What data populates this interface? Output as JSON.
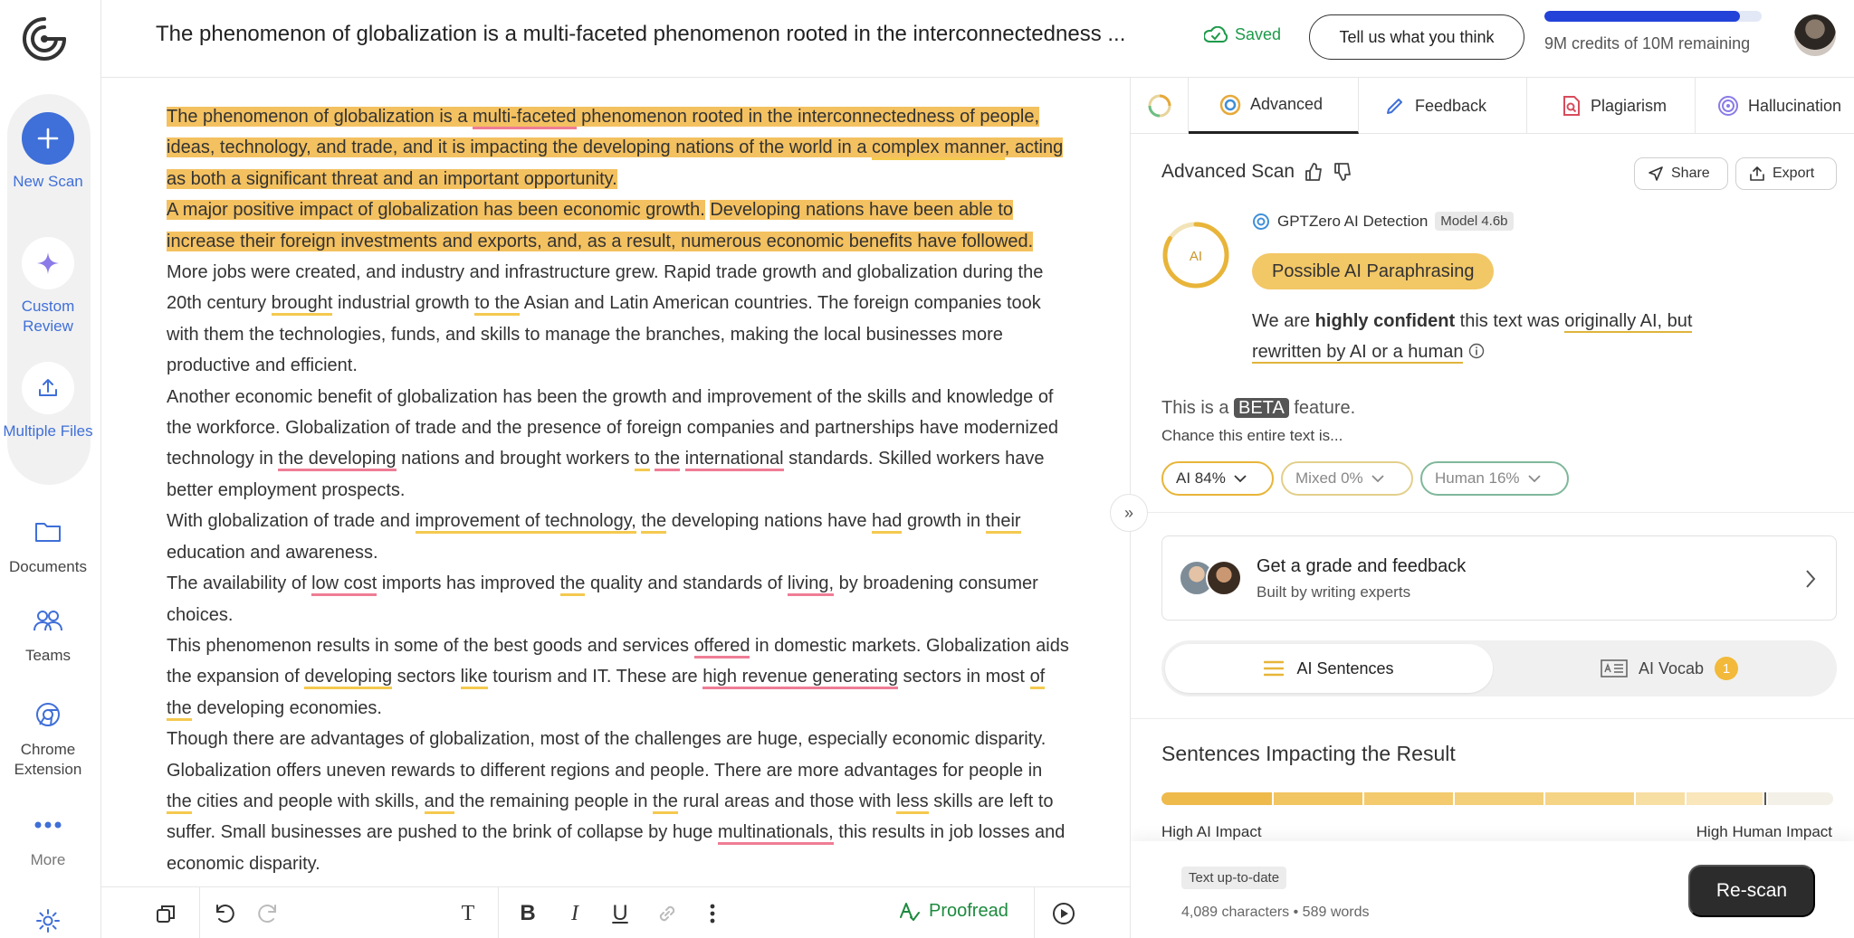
{
  "sidebar": {
    "new_scan": "New Scan",
    "custom_review": "Custom Review",
    "multiple_files": "Multiple Files",
    "documents": "Documents",
    "teams": "Teams",
    "chrome_extension": "Chrome Extension",
    "more": "More",
    "icons": {
      "logo": "gptzero-logo-icon",
      "new_scan": "plus-icon",
      "custom_review": "sparkle-icon",
      "multiple_files": "upload-icon",
      "documents": "folder-icon",
      "teams": "people-icon",
      "chrome_extension": "chrome-icon",
      "more": "dots-icon",
      "settings": "gear-icon"
    }
  },
  "header": {
    "doc_title": "The phenomenon of globalization is a multi-faceted phenomenon rooted in the interconnectedness ...",
    "saved": "Saved",
    "feedback_button": "Tell us what you think",
    "credits_text": "9M credits of 10M remaining",
    "credits_fraction": 0.9
  },
  "essay": {
    "p1": {
      "s1_a": "The phenomenon of globalization is a ",
      "s1_u1": "multi-faceted",
      "s1_b": " phenomenon rooted in the interconnectedness of people, ideas, technology, and trade, and it is impacting the developing nations of the world in a ",
      "s1_u2": "complex manner",
      "s1_c": ", acting as both a significant threat and an important opportunity."
    },
    "p2": {
      "h1": "A major positive impact of globalization has been economic growth.",
      "h2": "Developing nations have been able to increase their foreign investments and exports, and, as a result, numerous economic benefits have followed.",
      "a": " More jobs were created, and industry and infrastructure grew. Rapid trade growth and globalization during the 20th century ",
      "u1": "brought",
      "b": " industrial growth ",
      "u2": "to the",
      "c": " Asian and Latin American countries. The foreign companies took with them the technologies, funds, and skills to manage the branches, making the local businesses more productive and efficient."
    },
    "p3": {
      "a": "Another economic benefit of globalization has been the growth and improvement of the skills and knowledge of the workforce. Globalization of trade and the presence of foreign companies and partnerships have modernized technology in ",
      "r1": "the developing",
      "b": " nations and brought workers ",
      "y1": "to",
      "c": " ",
      "r2": "the",
      "d": " ",
      "r3": "international",
      "e": " standards. Skilled workers have better employment prospects."
    },
    "p4": {
      "a": "With globalization of trade and ",
      "y1": "improvement of technology,",
      "b": " ",
      "y2": "the",
      "c": " developing nations have ",
      "y3": "had",
      "d": " growth in ",
      "y4": "their",
      "e": " education and awareness."
    },
    "p5": {
      "a": "The availability of ",
      "r1": "low cost",
      "b": " imports has improved ",
      "y1": "the",
      "c": " quality and standards of ",
      "r2": "living,",
      "d": " by broadening consumer choices."
    },
    "p6": {
      "a": "This phenomenon results in some of the best goods and services ",
      "r1": "offered",
      "b": " in domestic markets. Globalization aids the expansion of ",
      "y1": "developing",
      "c": " sectors ",
      "y2": "like",
      "d": " tourism and IT. These are ",
      "r2": "high revenue generating",
      "e": " sectors in most ",
      "y3": "of the",
      "f": " developing economies."
    },
    "p7": {
      "a": "Though there are advantages of globalization, most of the challenges are huge, especially economic disparity. Globalization offers uneven rewards to different regions and people. There are more advantages for people in ",
      "y1": "the",
      "b": " cities and people with skills, ",
      "y2": "and",
      "c": " the remaining people in ",
      "y3": "the",
      "d": " rural areas and those with ",
      "y4": "less",
      "e": " skills are left to suffer. Small businesses are pushed to the brink of collapse by huge ",
      "r1": "multinationals,",
      "f": " this results in job losses and economic disparity."
    }
  },
  "toolbar": {
    "proofread": "Proofread",
    "icons": [
      "copy-icon",
      "undo-icon",
      "redo-icon",
      "text-format-icon",
      "bold-icon",
      "italic-icon",
      "underline-icon",
      "link-icon",
      "more-vertical-icon",
      "proofread-icon",
      "play-icon"
    ],
    "bold": "B",
    "italic": "I",
    "underline": "U",
    "text": "T"
  },
  "panel": {
    "tabs": [
      "Advanced",
      "Feedback",
      "Plagiarism",
      "Hallucination"
    ],
    "scan_title": "Advanced Scan",
    "share": "Share",
    "export": "Export",
    "ring_label": "AI",
    "detector": "GPTZero AI Detection",
    "model": "Model 4.6b",
    "verdict": "Possible AI Paraphrasing",
    "confidence_pre": "We are ",
    "confidence_bold": "highly confident",
    "confidence_mid": " this text was ",
    "confidence_link": "originally AI, but rewritten by AI or a human",
    "beta_pre": "This is a ",
    "beta": "BETA",
    "beta_post": " feature.",
    "chance": "Chance this entire text is...",
    "ai_pct": "AI 84%",
    "mixed_pct": "Mixed 0%",
    "human_pct": "Human 16%",
    "grade_title": "Get a grade and feedback",
    "grade_sub": "Built by writing experts",
    "ai_sentences": "AI Sentences",
    "ai_vocab": "AI Vocab",
    "ai_vocab_count": "1",
    "impact_title": "Sentences Impacting the Result",
    "impact_low": "High AI Impact",
    "impact_high": "High Human Impact",
    "up_to_date": "Text up-to-date",
    "counts": "4,089 characters • 589 words",
    "rescan": "Re-scan"
  },
  "colors": {
    "ai_highlight": "#f4c160",
    "underline_yellow": "#f4c94f",
    "underline_red": "#ef7d95",
    "accent_blue": "#2242d8",
    "saved_green": "#1d9a4a"
  }
}
